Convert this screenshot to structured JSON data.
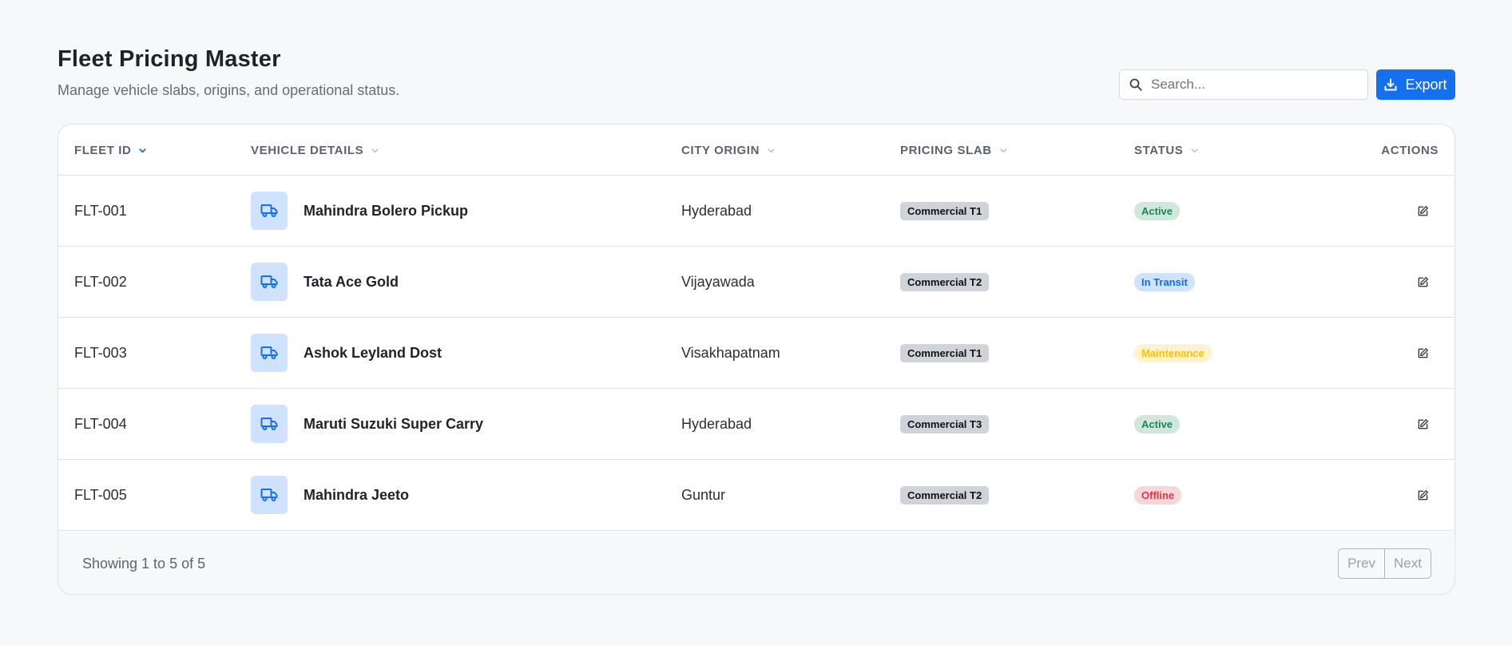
{
  "header": {
    "title": "Fleet Pricing Master",
    "subtitle": "Manage vehicle slabs, origins, and operational status."
  },
  "search": {
    "placeholder": "Search..."
  },
  "export_label": "Export",
  "columns": {
    "fleet_id": "FLEET ID",
    "vehicle_details": "VEHICLE DETAILS",
    "city_origin": "CITY ORIGIN",
    "pricing_slab": "PRICING SLAB",
    "status": "STATUS",
    "actions": "ACTIONS"
  },
  "rows": [
    {
      "fleet_id": "FLT-001",
      "vehicle": "Mahindra Bolero Pickup",
      "city": "Hyderabad",
      "slab": "Commercial T1",
      "status": "Active"
    },
    {
      "fleet_id": "FLT-002",
      "vehicle": "Tata Ace Gold",
      "city": "Vijayawada",
      "slab": "Commercial T2",
      "status": "In Transit"
    },
    {
      "fleet_id": "FLT-003",
      "vehicle": "Ashok Leyland Dost",
      "city": "Visakhapatnam",
      "slab": "Commercial T1",
      "status": "Maintenance"
    },
    {
      "fleet_id": "FLT-004",
      "vehicle": "Maruti Suzuki Super Carry",
      "city": "Hyderabad",
      "slab": "Commercial T3",
      "status": "Active"
    },
    {
      "fleet_id": "FLT-005",
      "vehicle": "Mahindra Jeeto",
      "city": "Guntur",
      "slab": "Commercial T2",
      "status": "Offline"
    }
  ],
  "footer": {
    "showing": "Showing 1 to 5 of 5",
    "prev_label": "Prev",
    "next_label": "Next"
  },
  "colors": {
    "accent": "#1570ef",
    "active": "#198754",
    "in_transit": "#0d6efd",
    "maintenance": "#ffc107",
    "offline": "#dc3545"
  },
  "icons": {
    "search": "search-icon",
    "export": "download-icon",
    "vehicle": "truck-icon",
    "edit": "edit-icon",
    "sort": "chevron-down-icon"
  }
}
